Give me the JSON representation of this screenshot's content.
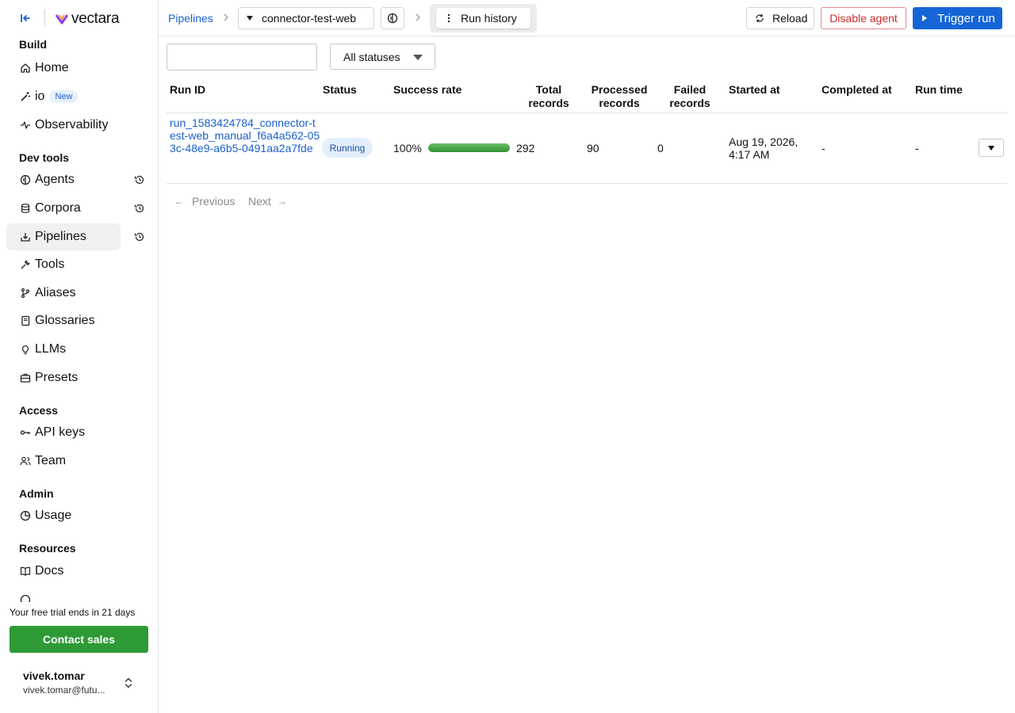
{
  "app": {
    "name": "vectara"
  },
  "sidebar": {
    "sections": {
      "build": "Build",
      "dev_tools": "Dev tools",
      "access": "Access",
      "admin": "Admin",
      "resources": "Resources"
    },
    "items": {
      "home": "Home",
      "io": "io",
      "io_badge": "New",
      "observability": "Observability",
      "agents": "Agents",
      "corpora": "Corpora",
      "pipelines": "Pipelines",
      "tools": "Tools",
      "aliases": "Aliases",
      "glossaries": "Glossaries",
      "llms": "LLMs",
      "presets": "Presets",
      "api_keys": "API keys",
      "team": "Team",
      "usage": "Usage",
      "docs": "Docs"
    },
    "active_item": "Pipelines",
    "trial_text": "Your free trial ends in 21 days",
    "contact_label": "Contact sales",
    "user": {
      "name": "vivek.tomar",
      "email": "vivek.tomar@futu..."
    }
  },
  "header": {
    "breadcrumb_root": "Pipelines",
    "agent_value": "connector-test-web",
    "active_tab": "Run history",
    "reload_label": "Reload",
    "disable_label": "Disable agent",
    "trigger_label": "Trigger run"
  },
  "filters": {
    "search_value": "",
    "status_value": "All statuses"
  },
  "table": {
    "columns": {
      "run_id": "Run ID",
      "status": "Status",
      "success_rate": "Success rate",
      "total_records": "Total records",
      "processed_records": "Processed records",
      "failed_records": "Failed records",
      "started_at": "Started at",
      "completed_at": "Completed at",
      "run_time": "Run time"
    },
    "rows": [
      {
        "run_id": "run_1583424784_connector-test-web_manual_f6a4a562-053c-48e9-a6b5-0491aa2a7fde",
        "status": "Running",
        "success_rate": "100%",
        "success_fraction": 1.0,
        "total_records": "292",
        "processed_records": "90",
        "failed_records": "0",
        "started_at": "Aug 19, 2026, 4:17 AM",
        "completed_at": "-",
        "run_time": "-"
      }
    ]
  },
  "pagination": {
    "previous_label": "Previous",
    "next_label": "Next"
  },
  "colors": {
    "accent": "#1565d8",
    "link": "#1a5fd0",
    "contact_green": "#2e9a35",
    "danger": "#d12b2b"
  }
}
